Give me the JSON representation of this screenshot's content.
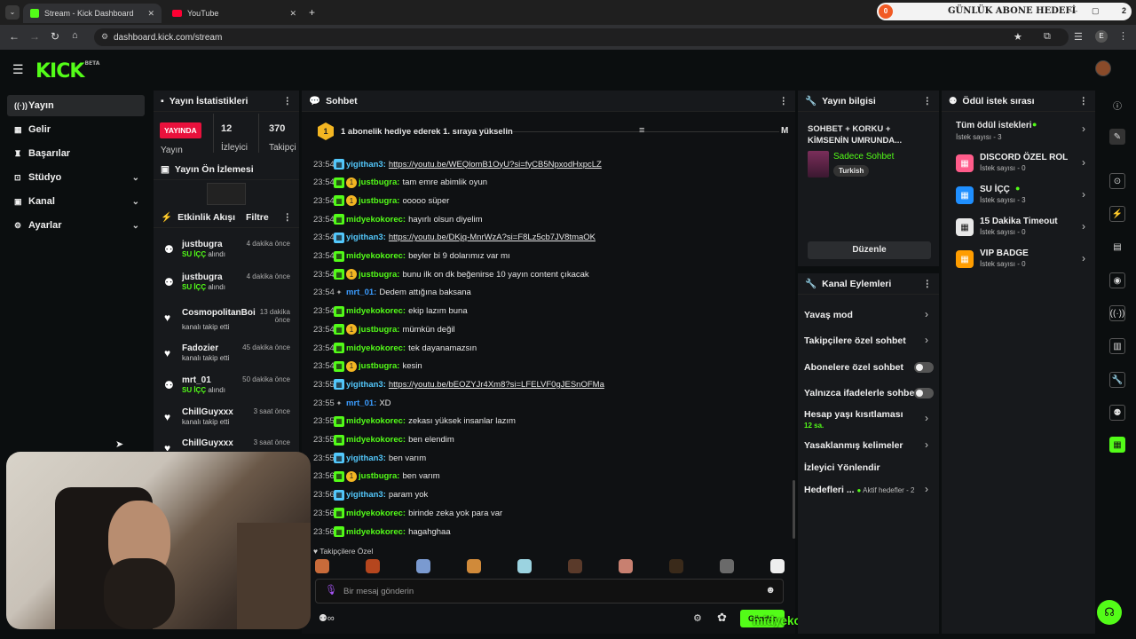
{
  "browser": {
    "tabs": [
      {
        "label": "Stream - Kick Dashboard"
      },
      {
        "label": "YouTube"
      }
    ],
    "url": "dashboard.kick.com/stream",
    "overlay": {
      "count": "0",
      "title": "GÜNLÜK ABONE HEDEFİ",
      "value": "2"
    },
    "profile": "E"
  },
  "sidebar": {
    "items": [
      {
        "label": "Yayın"
      },
      {
        "label": "Gelir"
      },
      {
        "label": "Başarılar"
      },
      {
        "label": "Stüdyo"
      },
      {
        "label": "Kanal"
      },
      {
        "label": "Ayarlar"
      }
    ]
  },
  "logo": {
    "text": "KICK",
    "beta": "BETA"
  },
  "stats": {
    "title": "Yayın İstatistikleri",
    "live": "YAYINDA",
    "status_label": "Yayın",
    "viewers": "12",
    "viewers_label": "İzleyici",
    "followers": "370",
    "followers_label": "Takipçi"
  },
  "preview": {
    "title": "Yayın Ön İzlemesi"
  },
  "activity": {
    "title": "Etkinlik Akışı",
    "filter": "Filtre",
    "events": [
      {
        "name": "justbugra",
        "sub_b": "SU İÇÇ",
        "sub": " alındı",
        "time": "4 dakika önce"
      },
      {
        "name": "justbugra",
        "sub_b": "SU İÇÇ",
        "sub": " alındı",
        "time": "4 dakika önce"
      },
      {
        "name": "CosmopolitanBoi",
        "sub_b": "",
        "sub": "kanalı takip etti",
        "time": "13 dakika önce"
      },
      {
        "name": "Fadozier",
        "sub_b": "",
        "sub": "kanalı takip etti",
        "time": "45 dakika önce"
      },
      {
        "name": "mrt_01",
        "sub_b": "SU İÇÇ",
        "sub": " alındı",
        "time": "50 dakika önce"
      },
      {
        "name": "ChillGuyxxx",
        "sub_b": "",
        "sub": "kanalı takip etti",
        "time": "3 saat önce"
      },
      {
        "name": "ChillGuyxxx",
        "sub_b": "",
        "sub": "",
        "time": "3 saat önce"
      }
    ]
  },
  "chat": {
    "title": "Sohbet",
    "pinned": "1 abonelik hediye ederek 1. sıraya yükselin",
    "pinned_rank": "1",
    "pinned_tail": "M",
    "messages": [
      {
        "t": "23:54",
        "u": "yigithan3:",
        "c": "#53c8fc",
        "m": "https://youtu.be/WEQlomB1OyU?si=fyCB5NpxodHxpcLZ",
        "link": true
      },
      {
        "t": "23:54",
        "u": "justbugra:",
        "c": "#53fc18",
        "m": "tam emre abimlik oyun"
      },
      {
        "t": "23:54",
        "u": "justbugra:",
        "c": "#53fc18",
        "m": "ooooo süper"
      },
      {
        "t": "23:54",
        "u": "midyekokorec:",
        "c": "#53fc18",
        "m": "hayırlı olsun diyelim"
      },
      {
        "t": "23:54",
        "u": "yigithan3:",
        "c": "#53c8fc",
        "m": "https://youtu.be/DKjq-MnrWzA?si=F8Lz5cb7JV8tmaOK",
        "link": true
      },
      {
        "t": "23:54",
        "u": "midyekokorec:",
        "c": "#53fc18",
        "m": "beyler bi 9 dolarımız var mı"
      },
      {
        "t": "23:54",
        "u": "justbugra:",
        "c": "#53fc18",
        "m": "bunu ilk on dk beğenirse 10 yayın content çıkacak"
      },
      {
        "t": "23:54",
        "u": "mrt_01:",
        "c": "#3b9cff",
        "m": "Dedem attığına baksana"
      },
      {
        "t": "23:54",
        "u": "midyekokorec:",
        "c": "#53fc18",
        "m": "ekip lazım buna"
      },
      {
        "t": "23:54",
        "u": "justbugra:",
        "c": "#53fc18",
        "m": "mümkün değil"
      },
      {
        "t": "23:54",
        "u": "midyekokorec:",
        "c": "#53fc18",
        "m": "tek dayanamazsın"
      },
      {
        "t": "23:54",
        "u": "justbugra:",
        "c": "#53fc18",
        "m": "kesin"
      },
      {
        "t": "23:55",
        "u": "yigithan3:",
        "c": "#53c8fc",
        "m": "https://youtu.be/bEOZYJr4Xm8?si=LFELVF0gJESnOFMa",
        "link": true
      },
      {
        "t": "23:55",
        "u": "mrt_01:",
        "c": "#3b9cff",
        "m": "XD"
      },
      {
        "t": "23:55",
        "u": "midyekokorec:",
        "c": "#53fc18",
        "m": "zekası yüksek insanlar lazım"
      },
      {
        "t": "23:55",
        "u": "midyekokorec:",
        "c": "#53fc18",
        "m": "ben elendim"
      },
      {
        "t": "23:55",
        "u": "yigithan3:",
        "c": "#53c8fc",
        "m": "ben varım"
      },
      {
        "t": "23:56",
        "u": "justbugra:",
        "c": "#53fc18",
        "m": "ben varım"
      },
      {
        "t": "23:56",
        "u": "yigithan3:",
        "c": "#53c8fc",
        "m": "param yok"
      },
      {
        "t": "23:56",
        "u": "midyekokorec:",
        "c": "#53fc18",
        "m": "birinde zeka yok para var"
      },
      {
        "t": "23:56",
        "u": "midyekokorec:",
        "c": "#53fc18",
        "m": "hagahghaa"
      }
    ],
    "followers_only": "Takipçilere Özel",
    "placeholder": "Bir mesaj gönderin",
    "send": "Gönder",
    "last_user": "midyekokorec:",
    "last_msg": "hagahghaa"
  },
  "stream_info": {
    "title": "Yayın bilgisi",
    "stream_title": "SOHBET + KORKU + KİMSENİN UMRUNDA...",
    "category": "Sadece Sohbet",
    "language": "Turkish",
    "edit": "Düzenle"
  },
  "actions": {
    "title": "Kanal Eylemleri",
    "slow": "Yavaş mod",
    "followers": "Takipçilere özel sohbet",
    "subs": "Abonelere özel sohbet",
    "emotes": "Yalnızca ifadelerle sohbet",
    "age": "Hesap yaşı kısıtlaması",
    "age_val": "12 sa.",
    "banned": "Yasaklanmış kelimeler",
    "redirect": "İzleyici Yönlendir",
    "goals": "Hedefleri ...",
    "goals_sub": "Aktif hedefler - 2"
  },
  "rewards": {
    "title": "Ödül istek sırası",
    "all": "Tüm ödül istekleri",
    "all_count": "İstek sayısı - 3",
    "items": [
      {
        "name": "DISCORD ÖZEL ROL",
        "count": "İstek sayısı - 0",
        "color": "#ff5c8a"
      },
      {
        "name": "SU İÇÇ",
        "count": "İstek sayısı - 3",
        "color": "#1f8fff"
      },
      {
        "name": "15 Dakika Timeout",
        "count": "İstek sayısı - 0",
        "color": "#e8e8e8"
      },
      {
        "name": "VIP BADGE",
        "count": "İstek sayısı - 0",
        "color": "#ff9d00"
      }
    ]
  }
}
